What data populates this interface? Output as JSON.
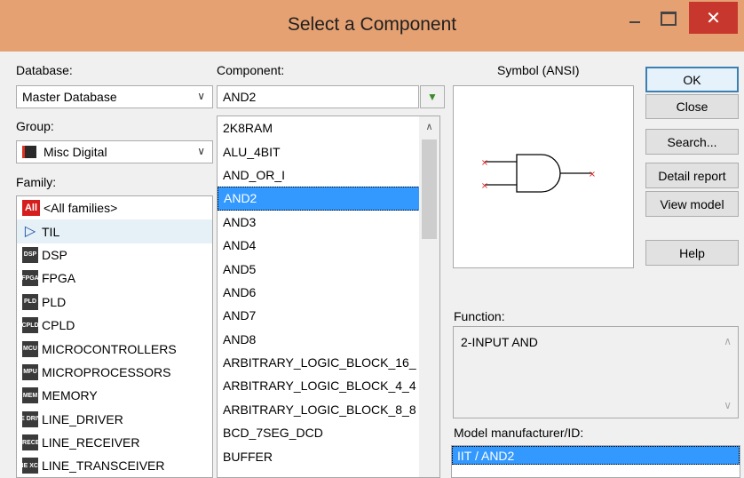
{
  "window": {
    "title": "Select a Component",
    "close_glyph": "✕"
  },
  "database": {
    "label": "Database:",
    "value": "Master Database"
  },
  "group": {
    "label": "Group:",
    "value": "Misc Digital"
  },
  "family": {
    "label": "Family:",
    "items": [
      {
        "icon": "All",
        "label": "<All families>"
      },
      {
        "icon": "TTL",
        "label": "TIL"
      },
      {
        "icon": "DSP",
        "label": "DSP"
      },
      {
        "icon": "FPGA",
        "label": "FPGA"
      },
      {
        "icon": "PLD",
        "label": "PLD"
      },
      {
        "icon": "CPLD",
        "label": "CPLD"
      },
      {
        "icon": "MCU",
        "label": "MICROCONTROLLERS"
      },
      {
        "icon": "MPU",
        "label": "MICROPROCESSORS"
      },
      {
        "icon": "MEM",
        "label": "MEMORY"
      },
      {
        "icon": "LINE DRIVER",
        "label": "LINE_DRIVER"
      },
      {
        "icon": "LINE RECEIVER",
        "label": "LINE_RECEIVER"
      },
      {
        "icon": "LINE XCVR",
        "label": "LINE_TRANSCEIVER"
      }
    ],
    "hovered_index": 1
  },
  "component": {
    "label": "Component:",
    "search_value": "AND2",
    "filter_icon": "filter-icon",
    "items": [
      "2K8RAM",
      "ALU_4BIT",
      "AND_OR_I",
      "AND2",
      "AND3",
      "AND4",
      "AND5",
      "AND6",
      "AND7",
      "AND8",
      "ARBITRARY_LOGIC_BLOCK_16_",
      "ARBITRARY_LOGIC_BLOCK_4_4",
      "ARBITRARY_LOGIC_BLOCK_8_8",
      "BCD_7SEG_DCD",
      "BUFFER"
    ],
    "selected_index": 3
  },
  "symbol": {
    "label": "Symbol (ANSI)"
  },
  "function": {
    "label": "Function:",
    "value": "2-INPUT AND"
  },
  "model": {
    "label": "Model manufacturer/ID:",
    "value": "IIT / AND2"
  },
  "buttons": {
    "ok": "OK",
    "close": "Close",
    "search": "Search...",
    "detail": "Detail report",
    "view_model": "View model",
    "help": "Help"
  },
  "colors": {
    "titlebar": "#e5a172",
    "close_button": "#c7372d",
    "selection": "#3399ff",
    "pin_marker": "#e02020"
  }
}
